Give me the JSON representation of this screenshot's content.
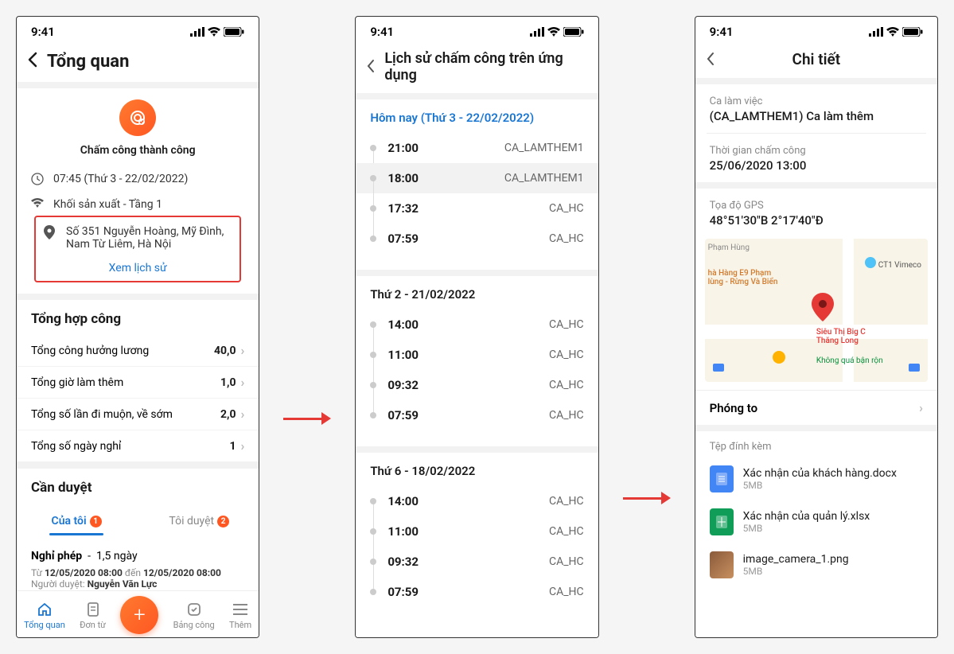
{
  "status_time": "9:41",
  "screen1": {
    "title": "Tổng quan",
    "success_label": "Chấm công thành công",
    "time_line": "07:45 (Thứ 3 - 22/02/2022)",
    "wifi_line": "Khối sản xuất - Tầng 1",
    "addr_line": "Số 351 Nguyễn Hoàng, Mỹ Đình, Nam Từ Liêm, Hà Nội",
    "history_link": "Xem lịch sử",
    "summary_title": "Tổng hợp công",
    "stats": [
      {
        "label": "Tổng công hưởng lương",
        "value": "40,0"
      },
      {
        "label": "Tổng giờ làm thêm",
        "value": "1,0"
      },
      {
        "label": "Tổng số lần đi muộn, về sớm",
        "value": "2,0"
      },
      {
        "label": "Tổng số ngày nghỉ",
        "value": "1"
      }
    ],
    "approve_title": "Cần duyệt",
    "tab1": "Của tôi",
    "tab1_badge": "1",
    "tab2": "Tôi duyệt",
    "tab2_badge": "2",
    "leave_title": "Nghỉ phép",
    "leave_sub": "1,5 ngày",
    "leave_range_pre": "Từ ",
    "leave_range_from": "12/05/2020 08:00",
    "leave_range_mid": " đến ",
    "leave_range_to": "12/05/2020 08:00",
    "approver_pre": "Người duyệt: ",
    "approver": "Nguyễn Văn Lực",
    "nav": [
      "Tổng quan",
      "Đơn từ",
      "Bảng công",
      "Thêm"
    ]
  },
  "screen2": {
    "title": "Lịch sử chấm công trên ứng dụng",
    "today": "Hôm nay (Thứ 3 - 22/02/2022)",
    "day1": [
      {
        "time": "21:00",
        "code": "CA_LAMTHEM1"
      },
      {
        "time": "18:00",
        "code": "CA_LAMTHEM1",
        "hl": true
      },
      {
        "time": "17:32",
        "code": "CA_HC"
      },
      {
        "time": "07:59",
        "code": "CA_HC",
        "last": true
      }
    ],
    "head2": "Thứ 2 - 21/02/2022",
    "day2": [
      {
        "time": "14:00",
        "code": "CA_HC"
      },
      {
        "time": "11:00",
        "code": "CA_HC"
      },
      {
        "time": "09:32",
        "code": "CA_HC"
      },
      {
        "time": "07:59",
        "code": "CA_HC",
        "last": true
      }
    ],
    "head3": "Thứ 6 - 18/02/2022",
    "day3": [
      {
        "time": "14:00",
        "code": "CA_HC"
      },
      {
        "time": "11:00",
        "code": "CA_HC"
      },
      {
        "time": "09:32",
        "code": "CA_HC"
      },
      {
        "time": "07:59",
        "code": "CA_HC",
        "last": true
      }
    ]
  },
  "screen3": {
    "title": "Chi tiết",
    "shift_label": "Ca làm việc",
    "shift_value": "(CA_LAMTHEM1) Ca làm thêm",
    "time_label": "Thời gian chấm công",
    "time_value": "25/06/2020 13:00",
    "gps_label": "Tọa độ GPS",
    "gps_value": "48°51′30″B 2°17′40″Đ",
    "map_places": {
      "p1": "Phạm Hùng",
      "p2": "CT1 Vimeco",
      "p3": "hà Hàng E9 Phạm\nlùng - Rừng Và Biển",
      "p4": "Siêu Thị Big C\nThăng Long",
      "p5": "Không quá bận rộn"
    },
    "zoom": "Phóng to",
    "attach_label": "Tệp đính kèm",
    "files": [
      {
        "name": "Xác nhận của khách hàng.docx",
        "size": "5MB",
        "type": "blue"
      },
      {
        "name": "Xác nhận của quản lý.xlsx",
        "size": "5MB",
        "type": "green"
      },
      {
        "name": "image_camera_1.png",
        "size": "5MB",
        "type": "img"
      }
    ]
  }
}
